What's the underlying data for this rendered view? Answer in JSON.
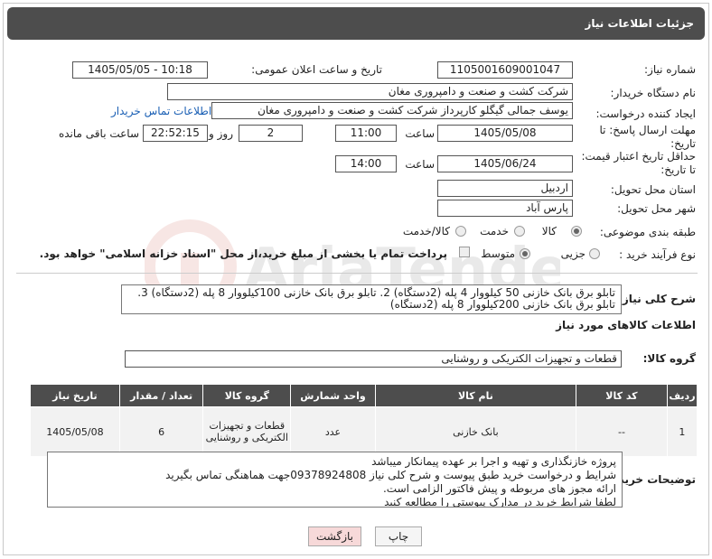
{
  "header": {
    "title": "جزئیات اطلاعات نیاز"
  },
  "labels": {
    "need_number": "شماره نیاز:",
    "announce_datetime": "تاریخ و ساعت اعلان عمومی:",
    "buyer_org": "نام دستگاه خریدار:",
    "requester": "ایجاد کننده درخواست:",
    "response_deadline": "مهلت ارسال پاسخ: تا تاریخ:",
    "price_validity": "حداقل تاریخ اعتبار قیمت: تا تاریخ:",
    "province": "استان محل تحویل:",
    "city": "شهر محل تحویل:",
    "category": "طبقه بندی موضوعی:",
    "purchase_type": "نوع فرآیند خرید :",
    "hour": "ساعت",
    "day_and": "روز و",
    "hours_remaining": "ساعت باقی مانده",
    "general_desc": "شرح کلی نیاز:",
    "goods_info": "اطلاعات کالاهای مورد نیاز",
    "goods_group": "گروه کالا:",
    "buyer_notes": "توضیحات خریدار:"
  },
  "values": {
    "need_number": "1105001609001047",
    "announce_datetime": "1405/05/05 - 10:18",
    "buyer_org": "شرکت کشت و صنعت و دامپروری مغان",
    "requester": "یوسف جمالی گیگلو کارپرداز شرکت کشت و صنعت و دامپروری مغان",
    "contact_link": "اطلاعات تماس خریدار",
    "deadline_date": "1405/05/08",
    "deadline_time": "11:00",
    "deadline_days": "2",
    "deadline_remaining": "22:52:15",
    "validity_date": "1405/06/24",
    "validity_time": "14:00",
    "province": "اردبیل",
    "city": "پارس آباد",
    "goods_group": "قطعات و تجهیزات الکتریکی و روشنایی"
  },
  "category_options": [
    {
      "label": "کالا",
      "selected": true
    },
    {
      "label": "خدمت",
      "selected": false
    },
    {
      "label": "کالا/خدمت",
      "selected": false
    }
  ],
  "purchase_options": [
    {
      "label": "جزیی",
      "selected": false
    },
    {
      "label": "متوسط",
      "selected": true
    }
  ],
  "payment_note": "پرداخت تمام یا بخشی از مبلغ خرید،از محل \"اسناد خزانه اسلامی\" خواهد بود.",
  "general_description": "تابلو برق بانک خازنی 50 کیلووار 4 پله  (2دستگاه) 2. تابلو برق بانک خازنی 100کیلووار 8 پله (2دستگاه) 3. تابلو برق بانک خازنی 200کیلووار 8 پله (2دستگاه)",
  "table": {
    "headers": [
      "ردیف",
      "کد کالا",
      "نام کالا",
      "واحد شمارش",
      "گروه کالا",
      "تعداد / مقدار",
      "تاریخ نیاز"
    ],
    "rows": [
      {
        "row": "1",
        "code": "--",
        "name": "بانک خازنی",
        "unit": "عدد",
        "group": "قطعات و تجهیزات الکتریکی و روشنایی",
        "qty": "6",
        "date": "1405/05/08"
      }
    ]
  },
  "buyer_notes": [
    "پروژه خازنگذاری و تهیه و اجرا بر عهده پیمانکار میباشد",
    "شرایط و درخواست خرید طبق پیوست و شرح کلی نیاز 09378924808جهت هماهنگی تماس بگیرید",
    "ارائه مجوز های مربوطه و پیش فاکتور الزامی است.",
    "لطفا شرایط خرید در مدارک پیوستی را مطالعه کنید"
  ],
  "buttons": {
    "print": "چاپ",
    "back": "بازگشت"
  }
}
